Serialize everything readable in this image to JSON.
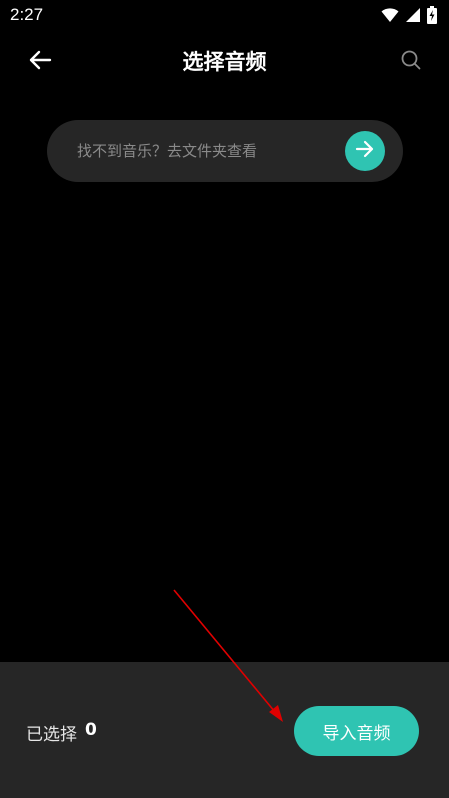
{
  "status_bar": {
    "time": "2:27",
    "icons": [
      "wifi-icon",
      "signal-icon",
      "battery-charging-icon"
    ]
  },
  "header": {
    "title": "选择音频",
    "back_icon": "arrow-left-icon",
    "search_icon": "search-icon"
  },
  "folder_link": {
    "text": "找不到音乐？去文件夹查看",
    "icon": "arrow-right-icon"
  },
  "footer": {
    "selected_label": "已选择",
    "selected_count": "0",
    "import_label": "导入音频"
  },
  "colors": {
    "background": "#000000",
    "panel": "#262626",
    "accent": "#2fc4b2",
    "annotation_arrow": "#e00000"
  }
}
